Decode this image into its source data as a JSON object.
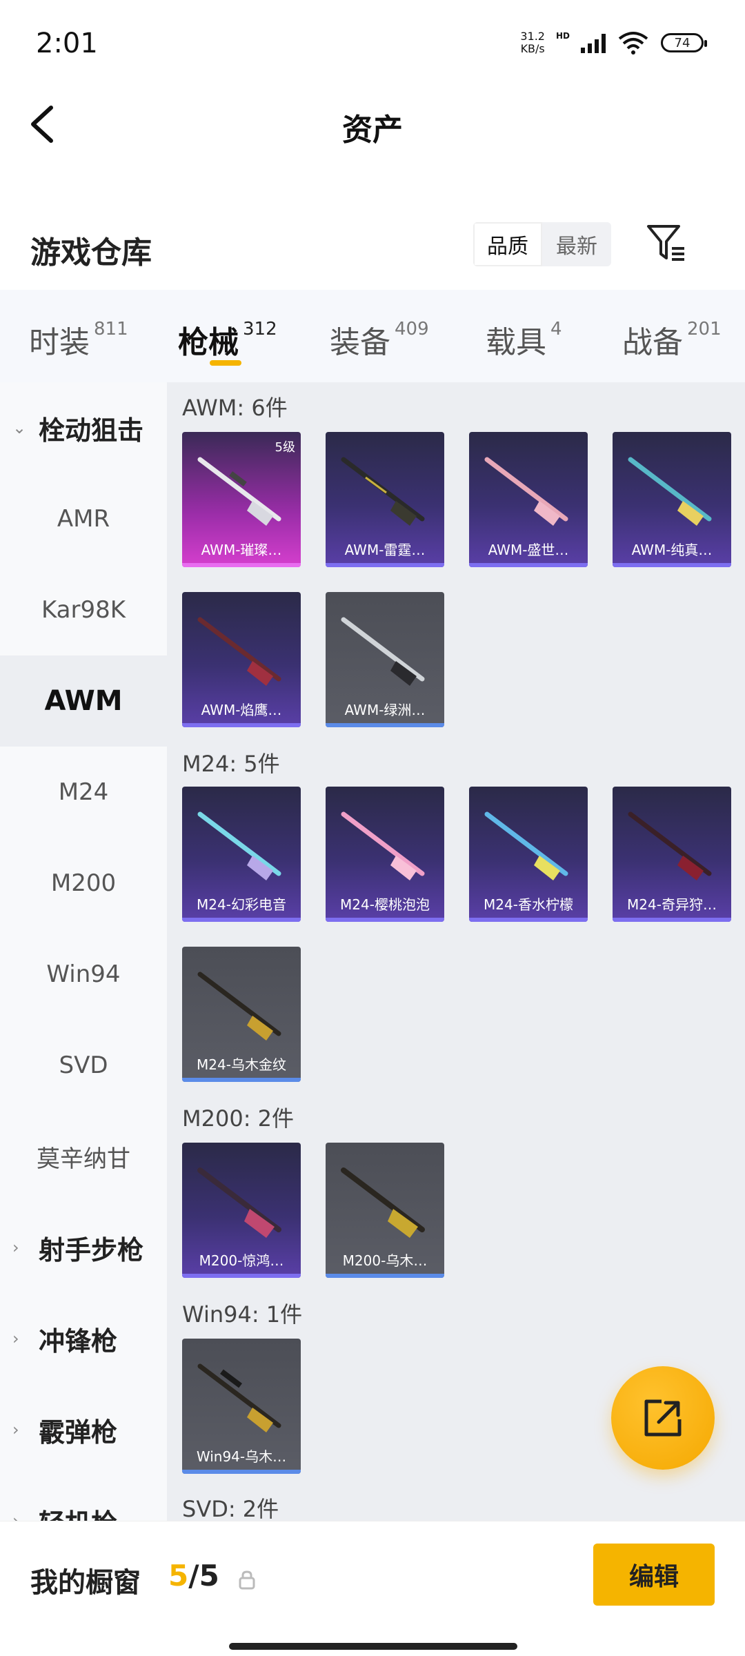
{
  "status": {
    "time": "2:01",
    "speed_value": "31.2",
    "speed_unit": "KB/s",
    "hd": "HD",
    "wifi_sub": "7",
    "battery": "74"
  },
  "header": {
    "title": "资产"
  },
  "warehouse": {
    "title": "游戏仓库",
    "sort_options": [
      "品质",
      "最新"
    ],
    "sort_selected": "品质"
  },
  "tabs": [
    {
      "label": "时装",
      "count": "811"
    },
    {
      "label": "枪械",
      "count": "312"
    },
    {
      "label": "装备",
      "count": "409"
    },
    {
      "label": "载具",
      "count": "4"
    },
    {
      "label": "战备",
      "count": "201"
    }
  ],
  "active_tab": "枪械",
  "sidebar": {
    "group1": "栓动狙击",
    "items": [
      "AMR",
      "Kar98K",
      "AWM",
      "M24",
      "M200",
      "Win94",
      "SVD",
      "莫辛纳甘"
    ],
    "selected": "AWM",
    "groups": [
      "射手步枪",
      "冲锋枪",
      "霰弹枪",
      "轻机枪"
    ]
  },
  "sections": {
    "awm": {
      "title": "AWM: 6件",
      "items": [
        {
          "name": "AWM-璀璨…",
          "level": "5级"
        },
        {
          "name": "AWM-雷霆…"
        },
        {
          "name": "AWM-盛世…"
        },
        {
          "name": "AWM-纯真…"
        },
        {
          "name": "AWM-焰鹰…"
        },
        {
          "name": "AWM-绿洲…"
        }
      ]
    },
    "m24": {
      "title": "M24: 5件",
      "items": [
        {
          "name": "M24-幻彩电音"
        },
        {
          "name": "M24-樱桃泡泡"
        },
        {
          "name": "M24-香水柠檬"
        },
        {
          "name": "M24-奇异狩…"
        },
        {
          "name": "M24-乌木金纹"
        }
      ]
    },
    "m200": {
      "title": "M200: 2件",
      "items": [
        {
          "name": "M200-惊鸿…"
        },
        {
          "name": "M200-乌木…"
        }
      ]
    },
    "win94": {
      "title": "Win94: 1件",
      "items": [
        {
          "name": "Win94-乌木…"
        }
      ]
    },
    "svd": {
      "title": "SVD: 2件"
    }
  },
  "bottom": {
    "label": "我的橱窗",
    "current": "5",
    "separator": "/",
    "total": "5",
    "edit": "编辑"
  },
  "colors": {
    "accent": "#f5b400",
    "rare_bg": "#3b3172",
    "legendary_bg": "#d63fce",
    "common_bg": "#555760"
  }
}
